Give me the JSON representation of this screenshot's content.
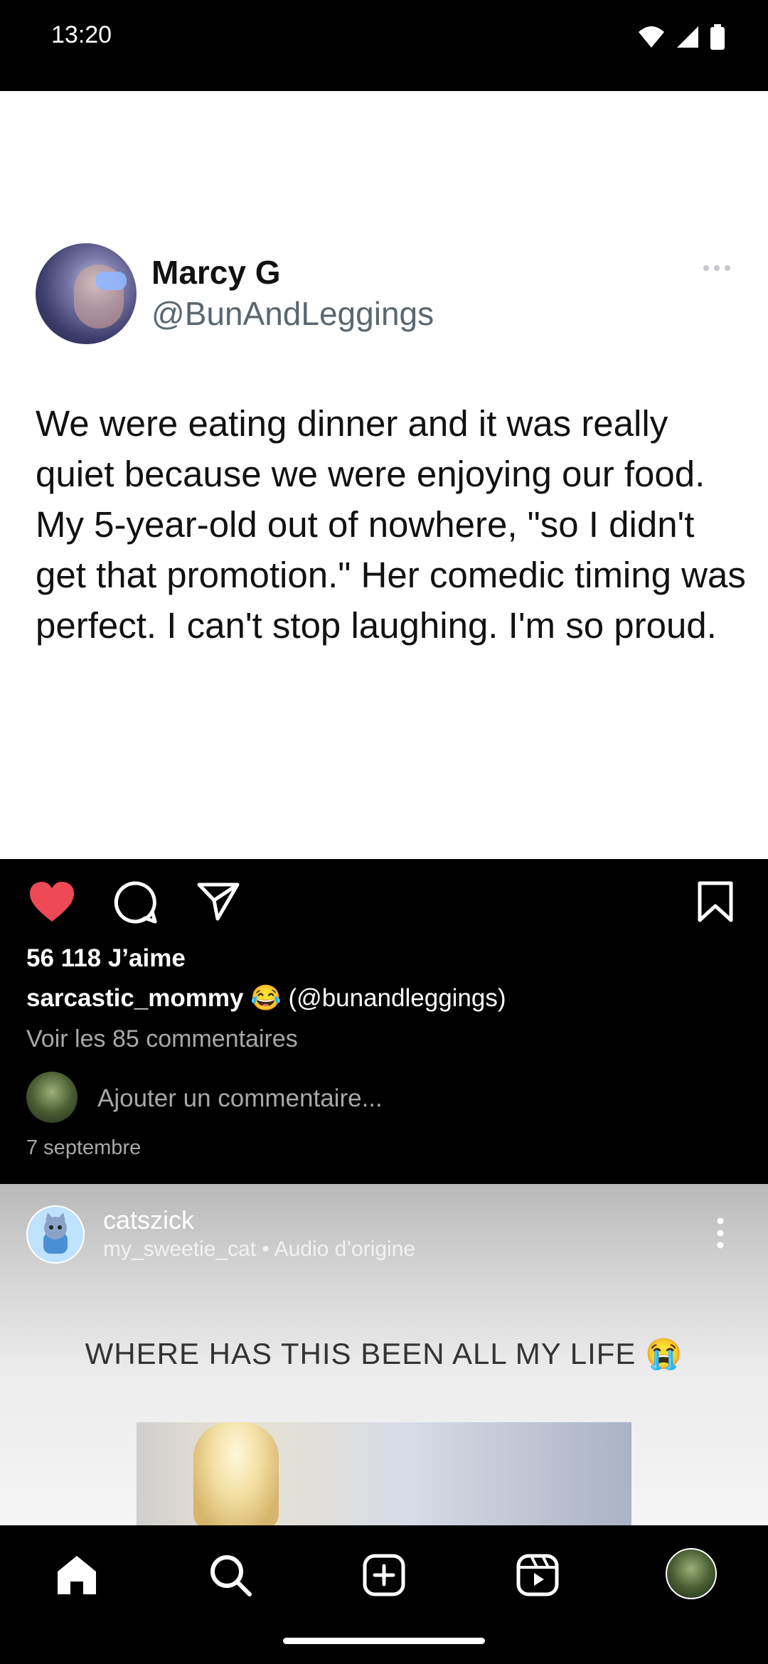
{
  "status_bar": {
    "time": "13:20"
  },
  "tweet": {
    "name": "Marcy G",
    "handle": "@BunAndLeggings",
    "text": "We were eating dinner and it was really quiet because we were enjoying our food. My 5-year-old out of nowhere, \"so I didn't get that promotion.\" Her comedic timing was perfect. I can't stop laughing. I'm so proud."
  },
  "post": {
    "likes": "56 118 J’aime",
    "caption_user": "sarcastic_mommy",
    "caption_text": "😂 (@bunandleggings)",
    "view_comments": "Voir les 85 commentaires",
    "comment_placeholder": "Ajouter un commentaire...",
    "date": "7 septembre",
    "liked": true,
    "colors": {
      "like": "#ed4956"
    }
  },
  "next_post": {
    "user": "catszick",
    "subtitle": "my_sweetie_cat • Audio d’origine",
    "headline": "WHERE HAS THIS BEEN ALL MY LIFE 😭"
  },
  "icons": [
    "heart-icon",
    "comment-icon",
    "share-icon",
    "bookmark-icon",
    "more-icon",
    "home-icon",
    "search-icon",
    "create-icon",
    "reels-icon"
  ]
}
